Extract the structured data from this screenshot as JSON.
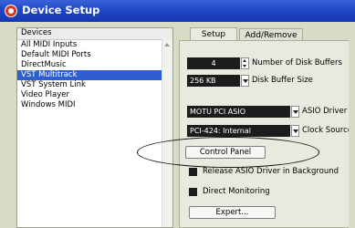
{
  "window": {
    "title": "Device Setup"
  },
  "devices": {
    "header": "Devices",
    "items": [
      {
        "label": "All MIDI Inputs",
        "selected": false
      },
      {
        "label": "Default MIDI Ports",
        "selected": false
      },
      {
        "label": "DirectMusic",
        "selected": false
      },
      {
        "label": "VST Multitrack",
        "selected": true
      },
      {
        "label": "VST System Link",
        "selected": false
      },
      {
        "label": "Video Player",
        "selected": false
      },
      {
        "label": "Windows MIDI",
        "selected": false
      }
    ]
  },
  "tabs": [
    {
      "label": "Setup",
      "active": true
    },
    {
      "label": "Add/Remove",
      "active": false
    }
  ],
  "settings": {
    "disk_buffers_value": "4",
    "disk_buffers_label": "Number of Disk Buffers",
    "buffer_size_value": "256 KB",
    "buffer_size_label": "Disk Buffer Size",
    "asio_driver_value": "MOTU PCI ASIO",
    "asio_driver_label": "ASIO Driver",
    "clock_source_value": "PCI-424: Internal",
    "clock_source_label": "Clock Source",
    "control_panel_label": "Control Panel",
    "release_asio_label": "Release ASIO Driver in Background",
    "direct_monitoring_label": "Direct Monitoring",
    "expert_label": "Expert..."
  },
  "colors": {
    "titlebar": "#1f47c6",
    "selection": "#2f5fce",
    "panel": "#e8eadf",
    "field": "#1c1c1c"
  }
}
